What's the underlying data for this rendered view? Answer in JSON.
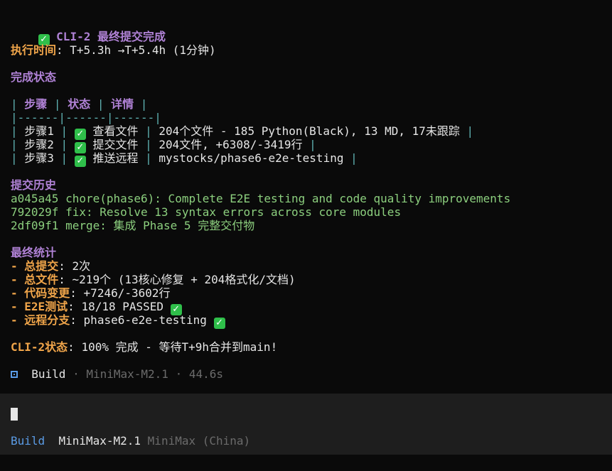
{
  "title": "CLI-2 最终提交完成",
  "exec_time": {
    "label": "执行时间",
    "value": "T+5.3h →T+5.4h (1分钟)"
  },
  "completion": {
    "heading": "完成状态",
    "header_row": [
      "步骤",
      "状态",
      "详情"
    ],
    "separator": "|------|------|------|",
    "rows": [
      {
        "step": "步骤1",
        "status": "查看文件",
        "detail": "204个文件 - 185 Python(Black), 13 MD, 17未跟踪"
      },
      {
        "step": "步骤2",
        "status": "提交文件",
        "detail": "204文件, +6308/-3419行"
      },
      {
        "step": "步骤3",
        "status": "推送远程",
        "detail": "mystocks/phase6-e2e-testing"
      }
    ]
  },
  "history": {
    "heading": "提交历史",
    "commits": [
      "a045a45 chore(phase6): Complete E2E testing and code quality improvements",
      "792029f fix: Resolve 13 syntax errors across core modules",
      "2df09f1 merge: 集成 Phase 5 完整交付物"
    ]
  },
  "stats": {
    "heading": "最终统计",
    "items": [
      {
        "label": "总提交",
        "value": "2次"
      },
      {
        "label": "总文件",
        "value": "~219个 (13核心修复 + 204格式化/文档)"
      },
      {
        "label": "代码变更",
        "value": "+7246/-3602行"
      },
      {
        "label": "E2E测试",
        "value": "18/18 PASSED"
      },
      {
        "label": "远程分支",
        "value": "phase6-e2e-testing"
      }
    ]
  },
  "cli_status": {
    "label": "CLI-2状态",
    "value": "100% 完成 - 等待T+9h合并到main!"
  },
  "build_line": {
    "mode": "Build",
    "model": "MiniMax-M2.1",
    "duration": "44.6s"
  },
  "status_bar": {
    "mode": "Build",
    "model": "MiniMax-M2.1",
    "provider": "MiniMax (China)"
  },
  "colors": {
    "heading": "#b082d6",
    "label": "#f0a54a",
    "table": "#5fb3b3",
    "commit": "#8ccf7e",
    "check": "#2fbf4a",
    "mode": "#5b9ce6"
  }
}
